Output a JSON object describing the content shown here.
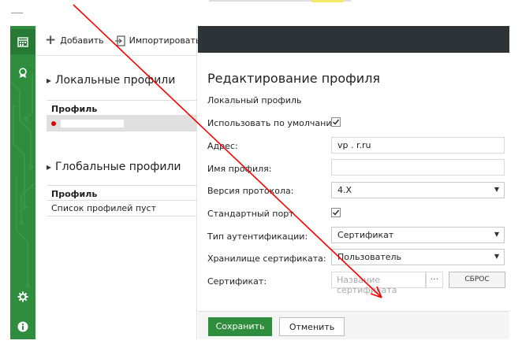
{
  "toolbar": {
    "add_label": "Добавить",
    "import_label": "Импортировать"
  },
  "left_panel": {
    "local_title": "Локальные профили",
    "local_header": "Профиль",
    "local_rows": [
      {
        "label": ""
      }
    ],
    "global_title": "Глобальные профили",
    "global_header": "Профиль",
    "global_empty": "Список профилей пуст"
  },
  "sidebar": {
    "icons": [
      "calendar-icon",
      "ribbon-icon",
      "gear-icon",
      "info-icon"
    ]
  },
  "form": {
    "title": "Редактирование профиля",
    "subtitle": "Локальный профиль",
    "use_default_label": "Использовать по умолчанию",
    "use_default_checked": true,
    "address_label": "Адрес:",
    "address_value": "vp                  .      r.ru",
    "profile_name_label": "Имя профиля:",
    "profile_name_value": "",
    "protocol_label": "Версия протокола:",
    "protocol_value": "4.X",
    "standard_port_label": "Стандартный порт",
    "standard_port_checked": true,
    "auth_type_label": "Тип аутентификации:",
    "auth_type_value": "Сертификат",
    "cert_store_label": "Хранилище сертификата:",
    "cert_store_value": "Пользователь",
    "cert_label": "Сертификат:",
    "cert_placeholder": "Название сертификата",
    "cert_browse": "···",
    "reset_label": "СБРОС"
  },
  "footer": {
    "save_label": "Сохранить",
    "cancel_label": "Отменить"
  },
  "colors": {
    "accent_green": "#2f8e3e",
    "dark_header": "#2e3338",
    "annotation_red": "#ff0000",
    "selected_row": "#e0e0e0",
    "status_dot": "#dd0000"
  }
}
